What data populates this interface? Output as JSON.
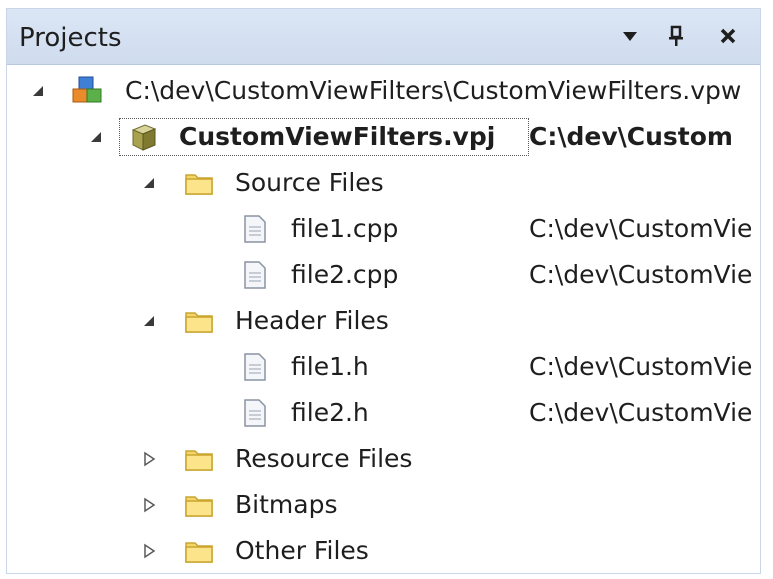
{
  "panel": {
    "title": "Projects",
    "buttons": {
      "dropdown": "▼",
      "pin": "ᵖ",
      "close": "✕"
    }
  },
  "tree": {
    "workspace": {
      "label": "C:\\dev\\CustomViewFilters\\CustomViewFilters.vpw",
      "expanded": true
    },
    "project": {
      "label": "CustomViewFilters.vpj",
      "path": "C:\\dev\\Custom",
      "expanded": true
    },
    "folders": [
      {
        "label": "Source Files",
        "expanded": true,
        "files": [
          {
            "name": "file1.cpp",
            "path": "C:\\dev\\CustomVie"
          },
          {
            "name": "file2.cpp",
            "path": "C:\\dev\\CustomVie"
          }
        ]
      },
      {
        "label": "Header Files",
        "expanded": true,
        "files": [
          {
            "name": "file1.h",
            "path": "C:\\dev\\CustomVie"
          },
          {
            "name": "file2.h",
            "path": "C:\\dev\\CustomVie"
          }
        ]
      },
      {
        "label": "Resource Files",
        "expanded": false,
        "files": []
      },
      {
        "label": "Bitmaps",
        "expanded": false,
        "files": []
      },
      {
        "label": "Other Files",
        "expanded": false,
        "files": []
      }
    ]
  },
  "colors": {
    "titlebar": "#d6e2f2",
    "folder": "#f3d66a",
    "folder_edge": "#c9a52f"
  },
  "icons": {
    "expanded": "triangle-down-right-icon",
    "collapsed": "triangle-right-outline-icon",
    "workspace": "workspace-icon",
    "project": "project-cube-icon",
    "folder": "folder-icon",
    "file": "file-icon"
  }
}
